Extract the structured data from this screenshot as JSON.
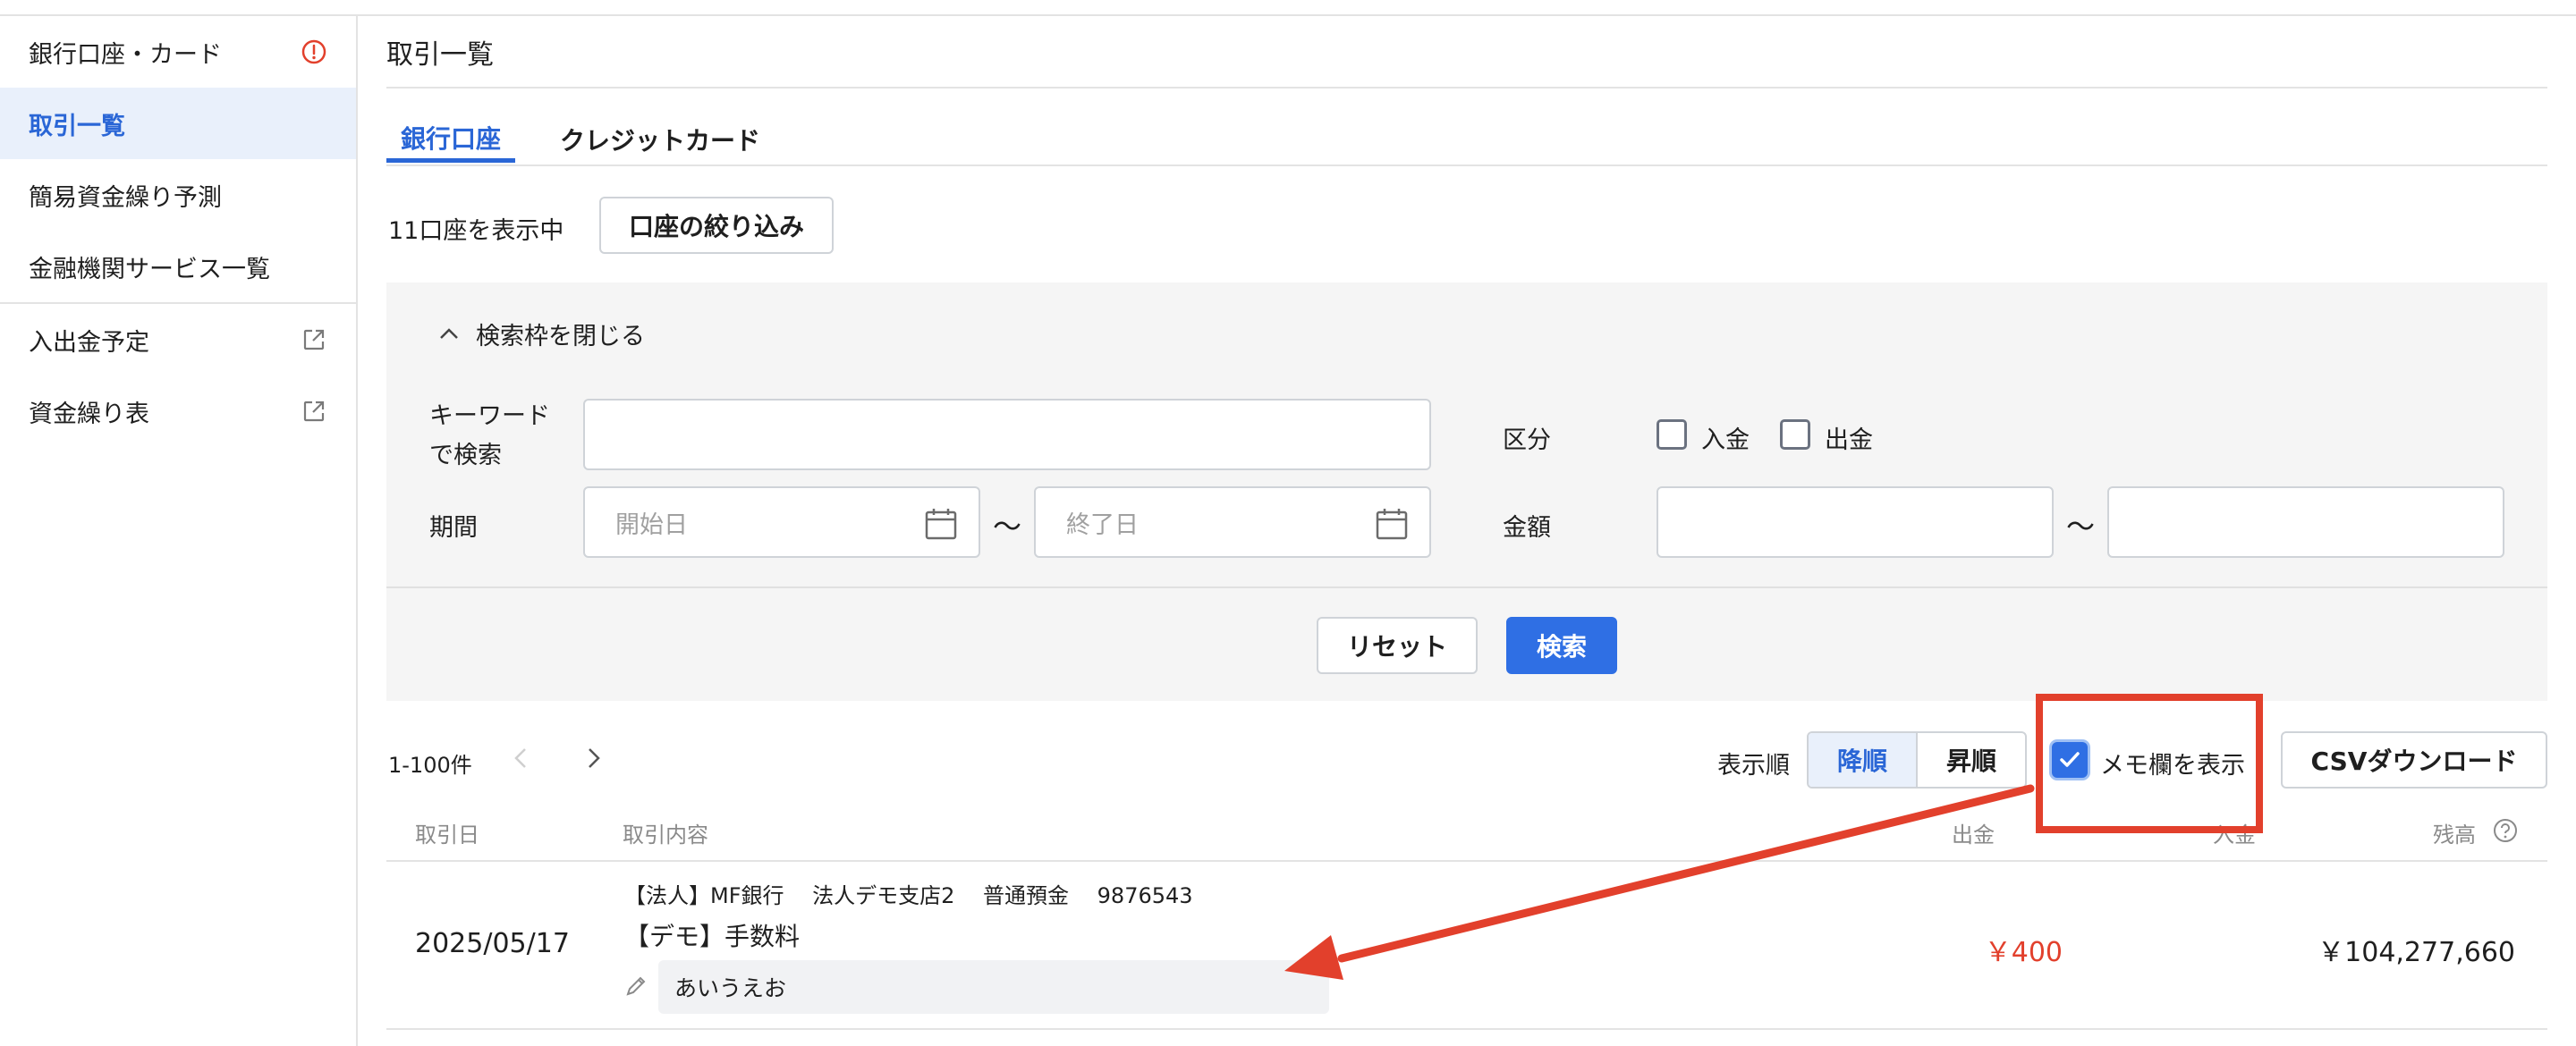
{
  "sidebar": {
    "items": [
      {
        "label": "銀行口座・カード"
      },
      {
        "label": "取引一覧"
      },
      {
        "label": "簡易資金繰り予測"
      },
      {
        "label": "金融機関サービス一覧"
      },
      {
        "label": "入出金予定"
      },
      {
        "label": "資金繰り表"
      }
    ]
  },
  "page": {
    "title": "取引一覧"
  },
  "tabs": [
    {
      "label": "銀行口座"
    },
    {
      "label": "クレジットカード"
    }
  ],
  "accounts": {
    "count_text": "11口座を表示中",
    "filter_button": "口座の絞り込み"
  },
  "search": {
    "toggle_label": "検索枠を閉じる",
    "keyword_label_line1": "キーワード",
    "keyword_label_line2": "で検索",
    "keyword_value": "",
    "period_label": "期間",
    "start_placeholder": "開始日",
    "end_placeholder": "終了日",
    "range_sep": "〜",
    "category_label": "区分",
    "deposit_label": "入金",
    "withdrawal_label": "出金",
    "amount_label": "金額",
    "reset_button": "リセット",
    "search_button": "検索"
  },
  "results": {
    "range_text": "1-100件",
    "sort_label": "表示順",
    "sort_desc": "降順",
    "sort_asc": "昇順",
    "memo_label": "メモ欄を表示",
    "memo_checked": true,
    "csv_button": "CSVダウンロード"
  },
  "table": {
    "headers": {
      "date": "取引日",
      "content": "取引内容",
      "withdrawal": "出金",
      "deposit": "入金",
      "balance": "残高"
    },
    "rows": [
      {
        "date": "2025/05/17",
        "account": "【法人】MF銀行　 法人デモ支店2　 普通預金　 9876543",
        "description": "【デモ】手数料",
        "memo": "あいうえお",
        "withdrawal": "￥400",
        "balance": "￥104,277,660"
      }
    ]
  },
  "colors": {
    "accent": "#2a66d6",
    "annotation": "#e2402c",
    "withdrawal": "#e2402c"
  }
}
